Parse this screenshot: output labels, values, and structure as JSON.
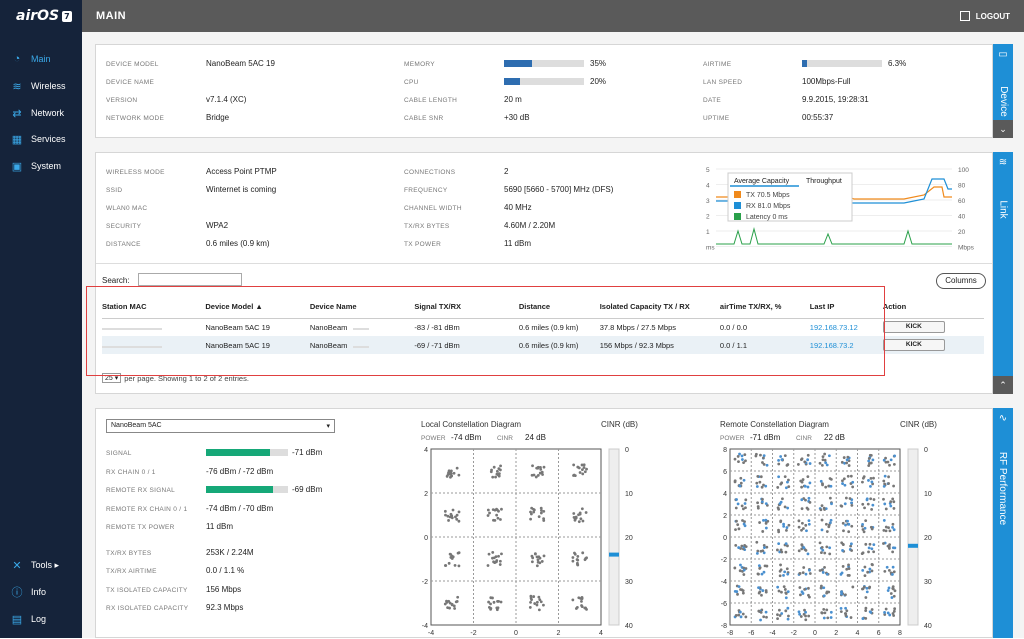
{
  "app": {
    "logo": "airOS",
    "logo_badge": "7",
    "title": "MAIN",
    "logout": "LOGOUT"
  },
  "nav": [
    {
      "label": "Main",
      "icon": "gauge-icon"
    },
    {
      "label": "Wireless",
      "icon": "wifi-icon"
    },
    {
      "label": "Network",
      "icon": "network-icon"
    },
    {
      "label": "Services",
      "icon": "services-icon"
    },
    {
      "label": "System",
      "icon": "chip-icon"
    }
  ],
  "nav_bottom": [
    {
      "label": "Tools ▸",
      "icon": "tools-icon"
    },
    {
      "label": "Info",
      "icon": "info-icon"
    },
    {
      "label": "Log",
      "icon": "log-icon"
    }
  ],
  "device": {
    "tab": "Device",
    "col1": [
      {
        "k": "DEVICE MODEL",
        "v": "NanoBeam 5AC 19"
      },
      {
        "k": "DEVICE NAME",
        "v": ""
      },
      {
        "k": "VERSION",
        "v": "v7.1.4 (XC)"
      },
      {
        "k": "NETWORK MODE",
        "v": "Bridge"
      }
    ],
    "col2": [
      {
        "k": "MEMORY",
        "v": "35%",
        "bar": 0.35
      },
      {
        "k": "CPU",
        "v": "20%",
        "bar": 0.2
      },
      {
        "k": "CABLE LENGTH",
        "v": "20 m"
      },
      {
        "k": "CABLE SNR",
        "v": "+30 dB"
      }
    ],
    "col3": [
      {
        "k": "AIRTIME",
        "v": "6.3%",
        "bar": 0.063
      },
      {
        "k": "LAN SPEED",
        "v": "100Mbps-Full"
      },
      {
        "k": "DATE",
        "v": "9.9.2015, 19:28:31"
      },
      {
        "k": "UPTIME",
        "v": "00:55:37"
      }
    ]
  },
  "link": {
    "tab": "Link",
    "col1": [
      {
        "k": "WIRELESS MODE",
        "v": "Access Point PTMP"
      },
      {
        "k": "SSID",
        "v": "Winternet is coming"
      },
      {
        "k": "WLAN0 MAC",
        "v": ""
      },
      {
        "k": "SECURITY",
        "v": "WPA2"
      },
      {
        "k": "DISTANCE",
        "v": "0.6 miles (0.9 km)"
      }
    ],
    "col2": [
      {
        "k": "CONNECTIONS",
        "v": "2"
      },
      {
        "k": "FREQUENCY",
        "v": "5690 [5660 - 5700] MHz (DFS)"
      },
      {
        "k": "CHANNEL WIDTH",
        "v": "40 MHz"
      },
      {
        "k": "TX/RX BYTES",
        "v": "4.60M / 2.20M"
      },
      {
        "k": "TX POWER",
        "v": "11 dBm"
      }
    ],
    "chart": {
      "tabs": [
        "Average Capacity",
        "Throughput"
      ],
      "legend": [
        {
          "label": "TX 70.5 Mbps",
          "color": "#f08a1c"
        },
        {
          "label": "RX 81.0 Mbps",
          "color": "#1e8fd6"
        },
        {
          "label": "Latency 0 ms",
          "color": "#2aa04a"
        }
      ],
      "left_ticks": [
        "5",
        "4",
        "3",
        "2",
        "1",
        "ms"
      ],
      "right_ticks": [
        "100",
        "80",
        "60",
        "40",
        "20",
        "Mbps"
      ]
    }
  },
  "stations": {
    "search_label": "Search:",
    "search_value": "",
    "columns_btn": "Columns",
    "headers": [
      "Station MAC",
      "Device Model ▲",
      "Device Name",
      "Signal TX/RX",
      "Distance",
      "Isolated Capacity TX / RX",
      "airTime TX/RX, %",
      "Last IP",
      "Action"
    ],
    "rows": [
      [
        "",
        "NanoBeam 5AC 19",
        "NanoBeam",
        "-83 / -81 dBm",
        "0.6 miles (0.9 km)",
        "37.8 Mbps / 27.5 Mbps",
        "0.0 / 0.0",
        "192.168.73.12",
        "KICK"
      ],
      [
        "",
        "NanoBeam 5AC 19",
        "NanoBeam",
        "-69 / -71 dBm",
        "0.6 miles (0.9 km)",
        "156 Mbps / 92.3 Mbps",
        "0.0 / 1.1",
        "192.168.73.2",
        "KICK"
      ]
    ],
    "per_page": "25",
    "per_page_text": "per page. Showing 1 to 2 of 2 entries."
  },
  "rf": {
    "tab": "RF Performance",
    "select": "NanoBeam 5AC",
    "stats": [
      {
        "k": "SIGNAL",
        "v": "-71 dBm",
        "bar": 0.78
      },
      {
        "k": "RX CHAIN 0 / 1",
        "v": "-76 dBm / -72 dBm"
      },
      {
        "k": "REMOTE RX SIGNAL",
        "v": "-69 dBm",
        "bar": 0.82
      },
      {
        "k": "REMOTE RX CHAIN 0 / 1",
        "v": "-74 dBm / -70 dBm"
      },
      {
        "k": "REMOTE TX POWER",
        "v": "11 dBm"
      },
      {
        "k": "TX/RX BYTES",
        "v": "253K / 2.24M"
      },
      {
        "k": "TX/RX AIRTIME",
        "v": "0.0 / 1.1 %"
      },
      {
        "k": "TX ISOLATED CAPACITY",
        "v": "156 Mbps"
      },
      {
        "k": "RX ISOLATED CAPACITY",
        "v": "92.3 Mbps"
      }
    ],
    "local": {
      "title": "Local Constellation Diagram",
      "cinr_label": "CINR (dB)",
      "power_k": "POWER",
      "power_v": "-74 dBm",
      "cinr_k": "CINR",
      "cinr_v": "24 dB",
      "yticks": [
        "4",
        "2",
        "0",
        "-2",
        "-4"
      ],
      "xticks": [
        "-4",
        "-2",
        "0",
        "2",
        "4"
      ],
      "scale": [
        "0",
        "10",
        "20",
        "30",
        "40"
      ]
    },
    "remote": {
      "title": "Remote Constellation Diagram",
      "cinr_label": "CINR (dB)",
      "power_k": "POWER",
      "power_v": "-71 dBm",
      "cinr_k": "CINR",
      "cinr_v": "22 dB",
      "yticks": [
        "8",
        "6",
        "4",
        "2",
        "0",
        "-2",
        "-4",
        "-6",
        "-8"
      ],
      "xticks": [
        "-8",
        "-6",
        "-4",
        "-2",
        "0",
        "2",
        "4",
        "6",
        "8"
      ],
      "scale": [
        "0",
        "10",
        "20",
        "30",
        "40"
      ]
    }
  },
  "colors": {
    "accent": "#1e8fd6",
    "sidebar": "#15233a",
    "topbar": "#5a5a5a",
    "highlight": "#e04040"
  }
}
